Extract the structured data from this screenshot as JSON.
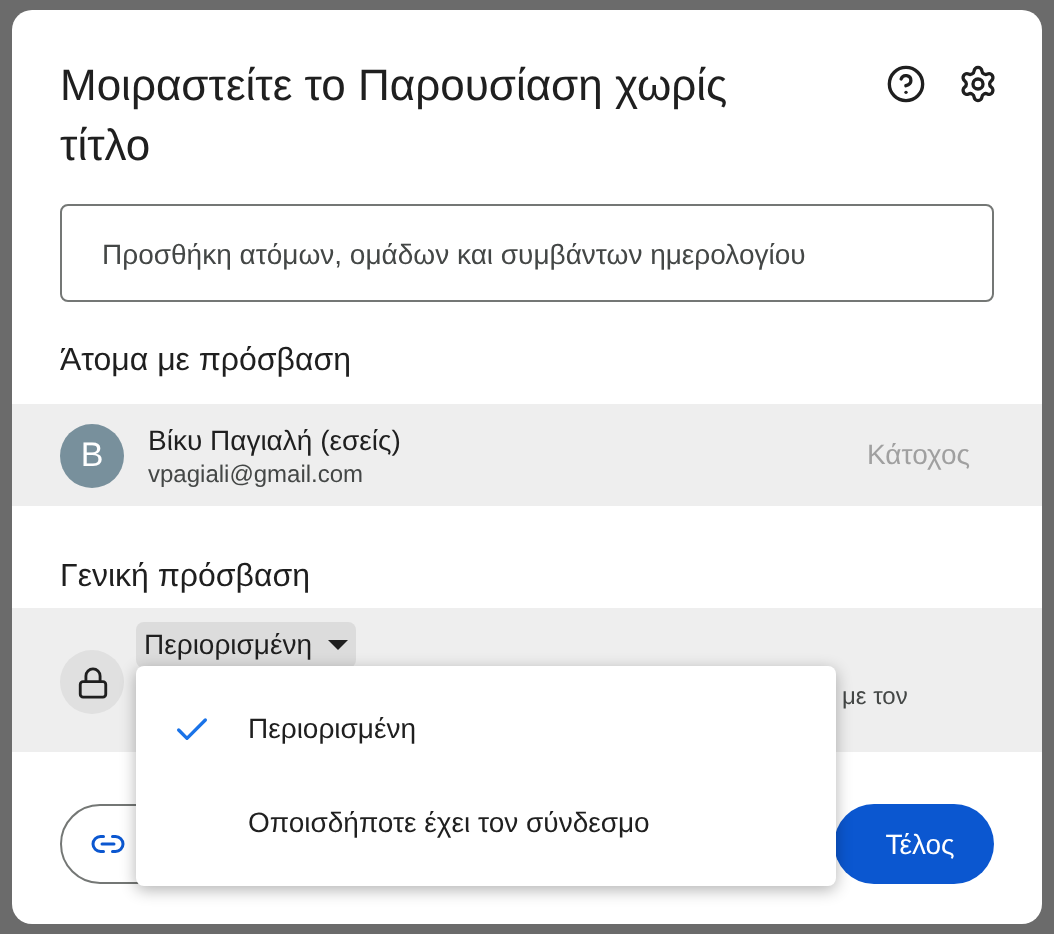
{
  "dialog": {
    "title": "Μοιραστείτε το Παρουσίαση χωρίς τίτλο"
  },
  "add_field": {
    "placeholder": "Προσθήκη ατόμων, ομάδων και συμβάντων ημερολογίου"
  },
  "people_heading": "Άτομα με πρόσβαση",
  "people": [
    {
      "initial": "B",
      "name": "Βίκυ Παγιαλή (εσείς)",
      "email": "vpagiali@gmail.com",
      "role": "Κάτοχος",
      "color": "#78909c"
    }
  ],
  "general_heading": "Γενική πρόσβαση",
  "general_access": {
    "value": "Περιορισμένη",
    "description_tail": "με τον"
  },
  "access_menu": [
    {
      "label": "Περιορισμένη",
      "selected": true
    },
    {
      "label": "Οποισδήποτε έχει τον σύνδεσμο",
      "selected": false
    }
  ],
  "done_button": "Τέλος"
}
